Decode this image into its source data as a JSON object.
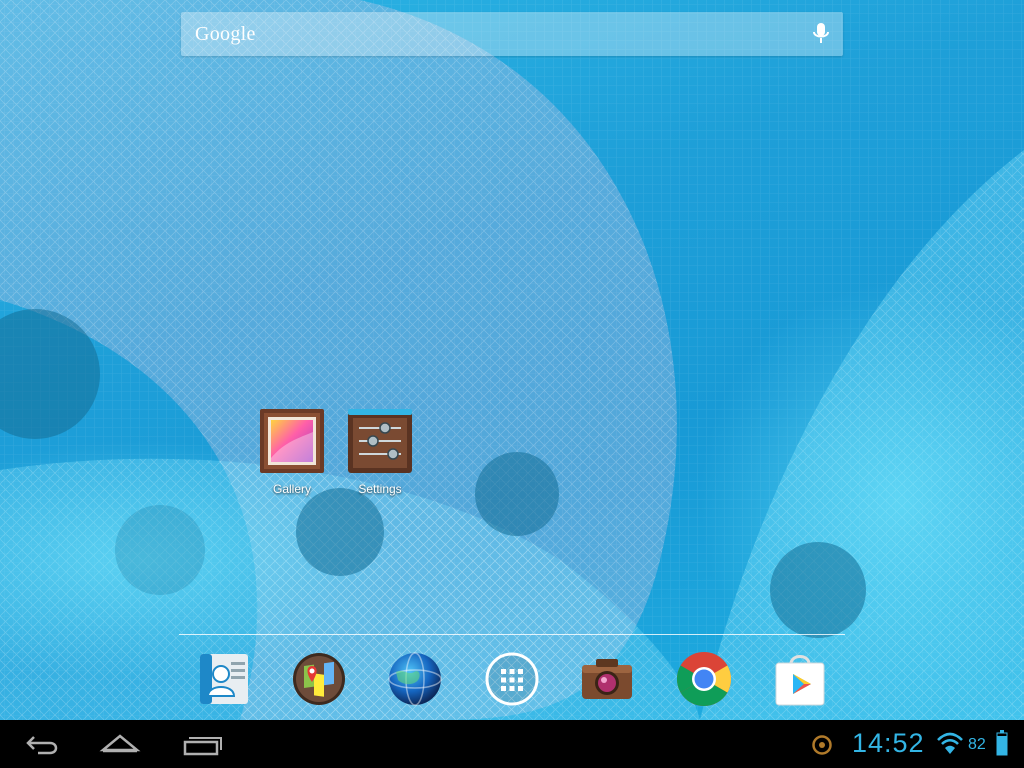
{
  "search": {
    "label": "Google",
    "mic_icon": "microphone-icon"
  },
  "desktop": {
    "shortcuts": [
      {
        "label": "Gallery",
        "icon": "gallery-icon"
      },
      {
        "label": "Settings",
        "icon": "settings-icon"
      }
    ]
  },
  "dock": {
    "apps": [
      {
        "icon": "contacts-icon"
      },
      {
        "icon": "maps-icon"
      },
      {
        "icon": "browser-globe-icon"
      },
      {
        "icon": "all-apps-icon"
      },
      {
        "icon": "camera-icon"
      },
      {
        "icon": "chrome-icon"
      },
      {
        "icon": "play-store-icon"
      }
    ]
  },
  "status_bar": {
    "time": "14:52",
    "battery_percent": "82",
    "notification_icon": "notification-circle-icon",
    "wifi_icon": "wifi-icon",
    "battery_icon": "battery-icon"
  },
  "navigation": {
    "back": "back-icon",
    "home": "home-icon",
    "recents": "recent-apps-icon"
  },
  "colors": {
    "wallpaper": "#1e9fd8",
    "accent": "#33b5e5",
    "navbar": "#000000"
  }
}
